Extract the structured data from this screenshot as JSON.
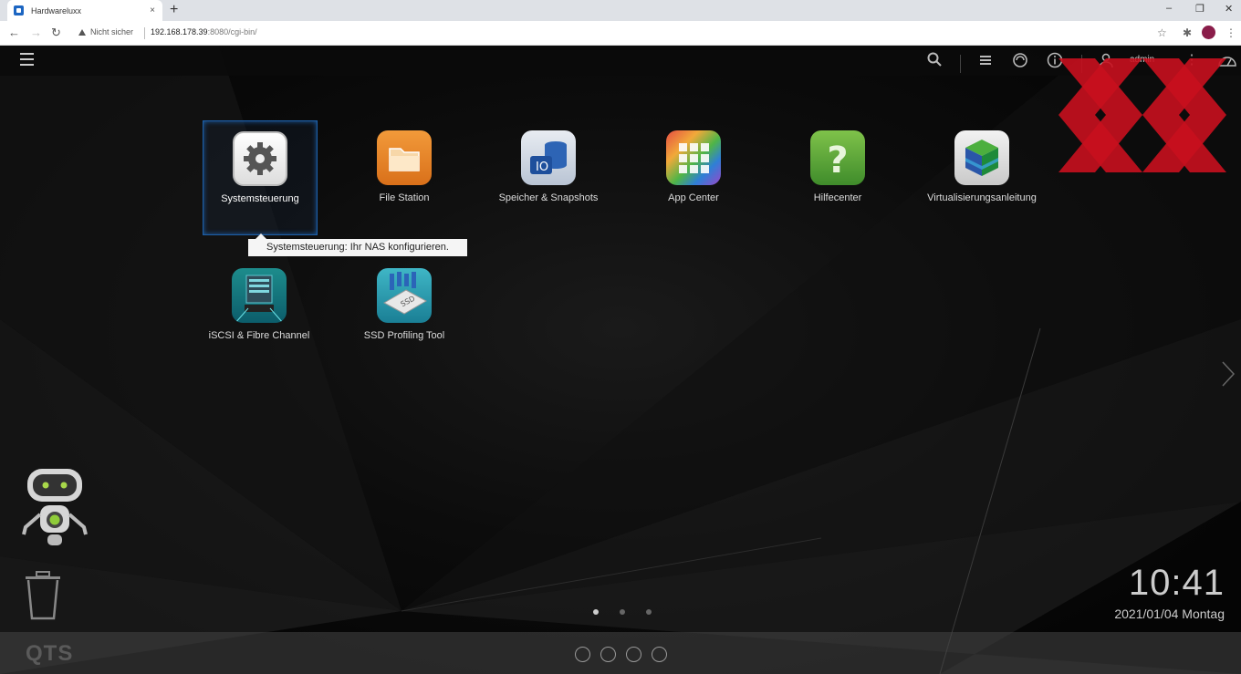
{
  "browser": {
    "tab_title": "Hardwareluxx",
    "tab_close": "×",
    "new_tab": "+",
    "win_minimize": "–",
    "win_restore": "❐",
    "win_close": "✕",
    "security_label": "Nicht sicher",
    "url_host": "192.168.178.39",
    "url_rest": ":8080/cgi-bin/"
  },
  "topbar": {
    "username": "admin",
    "icons": [
      "menu-icon",
      "search-icon",
      "stack-icon",
      "sync-icon",
      "info-icon",
      "user-icon",
      "more-icon",
      "dashboard-icon"
    ]
  },
  "apps": [
    {
      "label": "Systemsteuerung",
      "icon": "gear-icon",
      "selected": true
    },
    {
      "label": "File Station",
      "icon": "folder-icon"
    },
    {
      "label": "Speicher & Snapshots",
      "icon": "storage-icon"
    },
    {
      "label": "App Center",
      "icon": "grid-icon"
    },
    {
      "label": "Hilfecenter",
      "icon": "question-icon"
    },
    {
      "label": "Virtualisierungsanleitung",
      "icon": "cube-icon"
    },
    {
      "label": "iSCSI & Fibre Channel",
      "icon": "server-icon"
    },
    {
      "label": "SSD Profiling Tool",
      "icon": "ssd-icon"
    }
  ],
  "tooltip": "Systemsteuerung: Ihr NAS konfigurieren.",
  "clock": {
    "time": "10:41",
    "date": "2021/01/04 Montag"
  },
  "bottombar": {
    "brand": "QTS"
  },
  "colors": {
    "accent": "#1d5fa8",
    "watermark": "#c8101e"
  }
}
